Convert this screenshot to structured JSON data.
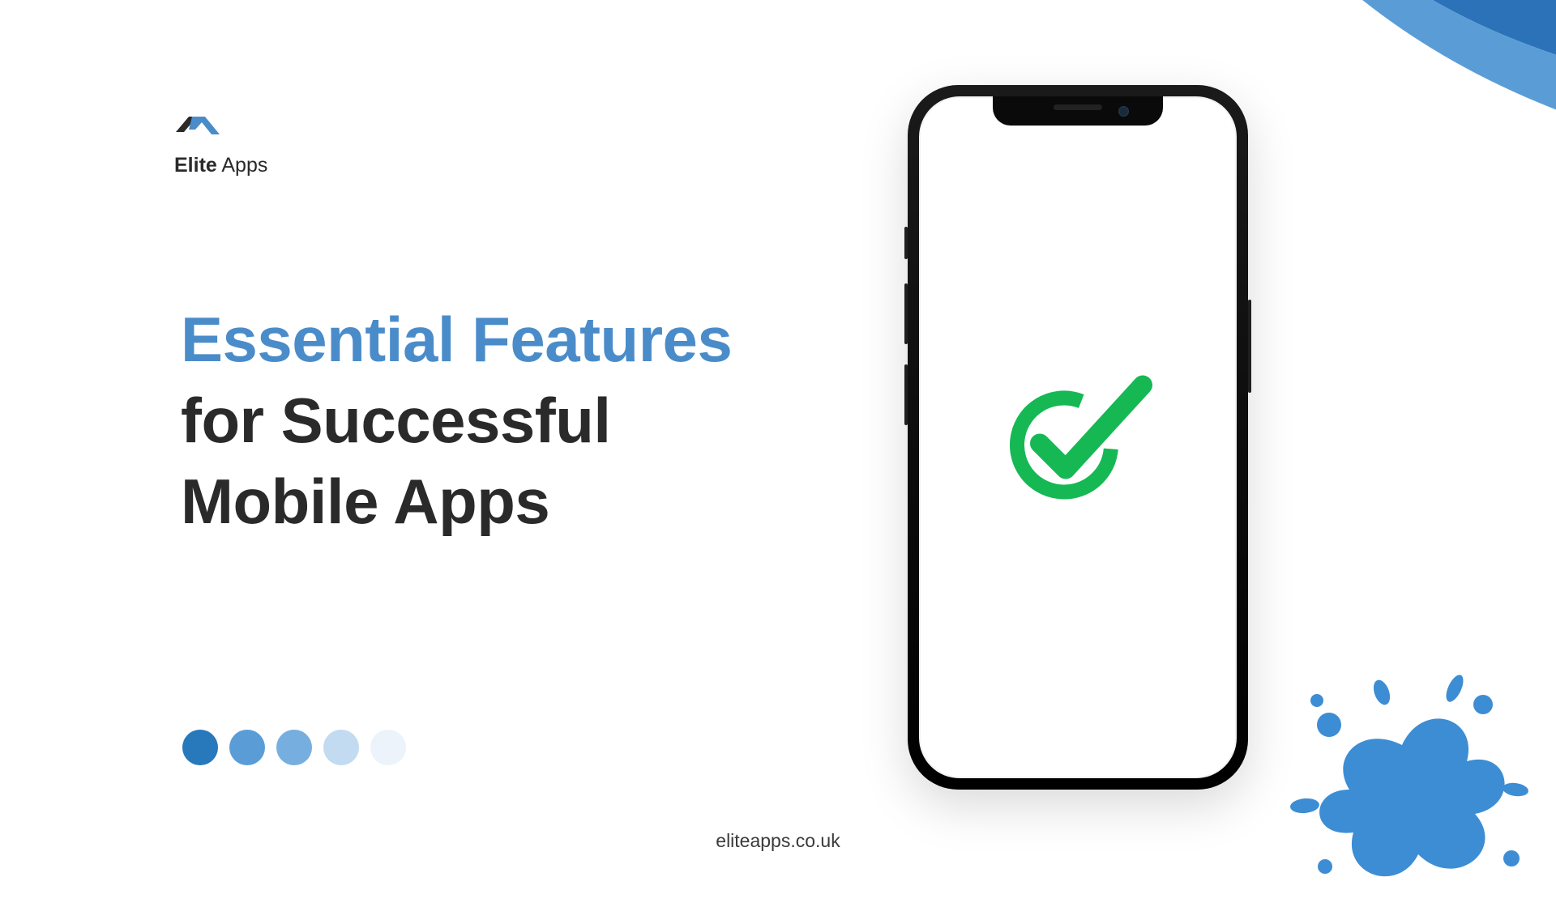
{
  "logo": {
    "brand_part1": "Elite",
    "brand_part2": "Apps"
  },
  "heading": {
    "accent_text": "Essential Features",
    "dark_word": "for",
    "dark_rest": "Successful Mobile Apps"
  },
  "footer": {
    "url": "eliteapps.co.uk"
  },
  "colors": {
    "accent_blue": "#4a8cc9",
    "dark_text": "#2a2a2a",
    "check_green": "#1abf5a",
    "swoosh_dark": "#2b72b8",
    "swoosh_light": "#5a9dd6",
    "splat_blue": "#3d8dd4"
  }
}
